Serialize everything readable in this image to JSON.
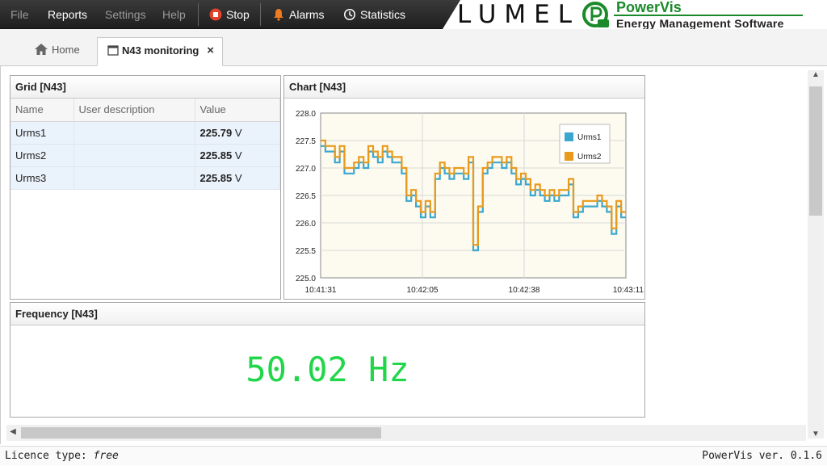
{
  "menu": {
    "file": "File",
    "reports": "Reports",
    "settings": "Settings",
    "help": "Help",
    "stop": "Stop",
    "alarms": "Alarms",
    "statistics": "Statistics"
  },
  "logo": {
    "brand": "LUMEL",
    "product": "PowerVis",
    "tagline": "Energy Management Software"
  },
  "tabs": {
    "home": "Home",
    "monitoring": "N43 monitoring",
    "close": "×"
  },
  "grid": {
    "title": "Grid [N43]",
    "columns": [
      "Name",
      "User description",
      "Value"
    ],
    "rows": [
      {
        "name": "Urms1",
        "description": "",
        "value": "225.79",
        "unit": "V"
      },
      {
        "name": "Urms2",
        "description": "",
        "value": "225.85",
        "unit": "V"
      },
      {
        "name": "Urms3",
        "description": "",
        "value": "225.85",
        "unit": "V"
      }
    ]
  },
  "chart": {
    "title": "Chart [N43]"
  },
  "chart_data": {
    "type": "line",
    "x_ticks": [
      "10:41:31",
      "10:42:05",
      "10:42:38",
      "10:43:11"
    ],
    "ylim": [
      225.0,
      228.0
    ],
    "y_ticks": [
      "225.0",
      "225.5",
      "226.0",
      "226.5",
      "227.0",
      "227.5",
      "228.0"
    ],
    "grid": true,
    "legend": "top-right",
    "series": [
      {
        "name": "Urms1",
        "color": "#3ba7cf",
        "values": [
          227.4,
          227.3,
          227.3,
          227.1,
          227.3,
          226.9,
          226.9,
          227.0,
          227.1,
          227.0,
          227.3,
          227.2,
          227.1,
          227.3,
          227.2,
          227.1,
          227.1,
          226.9,
          226.4,
          226.5,
          226.3,
          226.1,
          226.3,
          226.1,
          226.8,
          227.0,
          226.9,
          226.8,
          226.9,
          226.9,
          226.8,
          227.1,
          225.5,
          226.2,
          226.9,
          227.0,
          227.1,
          227.1,
          227.0,
          227.1,
          226.9,
          226.7,
          226.8,
          226.7,
          226.5,
          226.6,
          226.5,
          226.4,
          226.5,
          226.4,
          226.5,
          226.5,
          226.7,
          226.1,
          226.2,
          226.3,
          226.3,
          226.3,
          226.4,
          226.3,
          226.2,
          225.8,
          226.3,
          226.1
        ]
      },
      {
        "name": "Urms2",
        "color": "#e99a1c",
        "values": [
          227.5,
          227.4,
          227.4,
          227.2,
          227.4,
          227.0,
          227.0,
          227.1,
          227.2,
          227.1,
          227.4,
          227.3,
          227.2,
          227.4,
          227.3,
          227.2,
          227.2,
          227.0,
          226.5,
          226.6,
          226.4,
          226.2,
          226.4,
          226.2,
          226.9,
          227.1,
          227.0,
          226.9,
          227.0,
          227.0,
          226.9,
          227.2,
          225.6,
          226.3,
          227.0,
          227.1,
          227.2,
          227.2,
          227.1,
          227.2,
          227.0,
          226.8,
          226.9,
          226.8,
          226.6,
          226.7,
          226.6,
          226.5,
          226.6,
          226.5,
          226.6,
          226.6,
          226.8,
          226.2,
          226.3,
          226.4,
          226.4,
          226.4,
          226.5,
          226.4,
          226.3,
          225.9,
          226.4,
          226.2
        ]
      }
    ]
  },
  "frequency": {
    "title": "Frequency [N43]",
    "value": "50.02 Hz"
  },
  "status": {
    "licence_label": "Licence type:",
    "licence_value": "free",
    "version": "PowerVis ver. 0.1.6"
  }
}
